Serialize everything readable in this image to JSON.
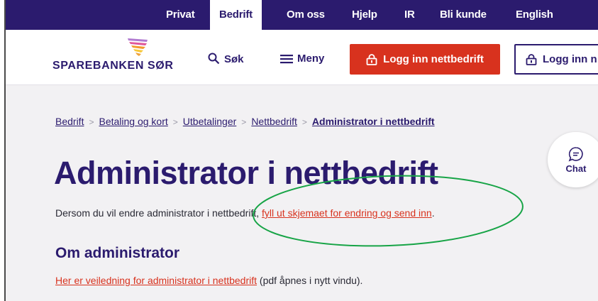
{
  "topnav": {
    "items": [
      {
        "label": "Privat",
        "active": false
      },
      {
        "label": "Bedrift",
        "active": true
      },
      {
        "label": "Om oss",
        "active": false
      },
      {
        "label": "Hjelp",
        "active": false
      },
      {
        "label": "IR",
        "active": false
      },
      {
        "label": "Bli kunde",
        "active": false
      },
      {
        "label": "English",
        "active": false
      }
    ]
  },
  "header": {
    "logo_text": "SPAREBANKEN SØR",
    "search_label": "Søk",
    "menu_label": "Meny",
    "login_primary_label": "Logg inn nettbedrift",
    "login_secondary_label": "Logg inn n"
  },
  "breadcrumb": {
    "items": [
      "Bedrift",
      "Betaling og kort",
      "Utbetalinger",
      "Nettbedrift"
    ],
    "current": "Administrator i nettbedrift"
  },
  "main": {
    "title": "Administrator i nettbedrift",
    "intro_text": "Dersom du vil endre administrator i nettbedrift, ",
    "intro_link": "fyll ut skjemaet for endring og send inn",
    "intro_end": ".",
    "section_title": "Om administrator",
    "guide_link": "Her er veiledning for administrator i nettbedrift",
    "guide_suffix": " (pdf åpnes i nytt vindu)."
  },
  "chat": {
    "label": "Chat"
  },
  "colors": {
    "brand_purple": "#2b1b6e",
    "brand_red": "#d8321e",
    "annotation_green": "#17a446",
    "page_bg": "#f2f1f3"
  }
}
